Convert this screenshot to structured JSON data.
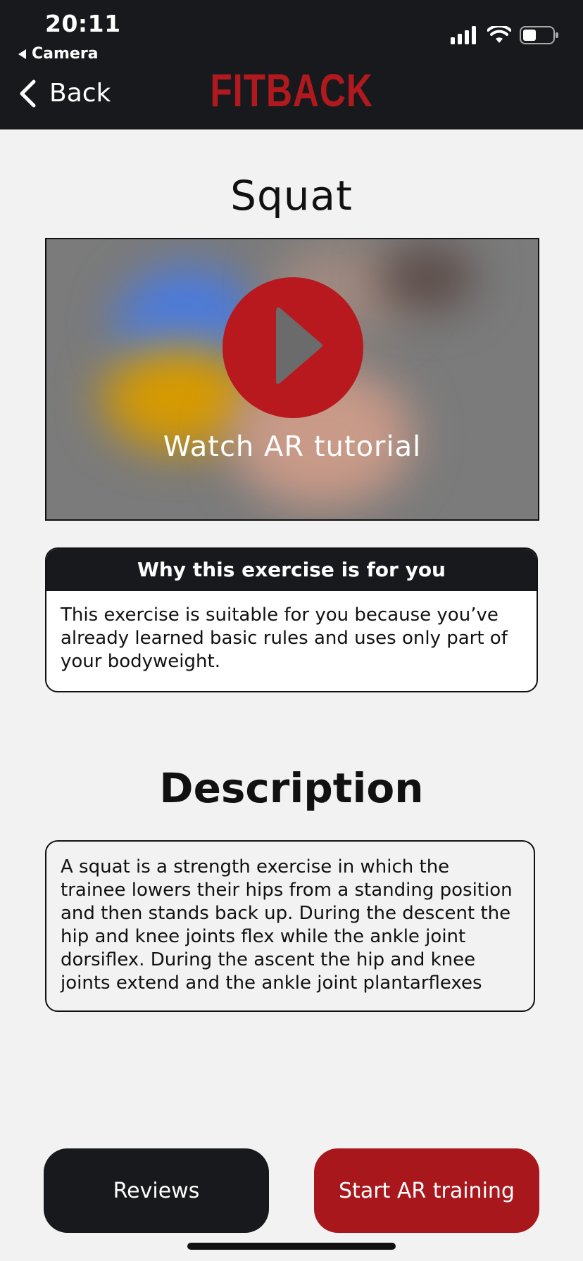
{
  "status_bar": {
    "time": "20:11",
    "back_app": "Camera"
  },
  "nav": {
    "back_label": "Back",
    "logo": "FITBACK"
  },
  "exercise": {
    "title": "Squat",
    "video_label": "Watch AR tutorial"
  },
  "why_card": {
    "title": "Why this exercise is for you",
    "body": "This exercise is suitable for you because you’ve already learned basic rules and uses only part of your bodyweight."
  },
  "description": {
    "heading": "Description",
    "body": "A squat is a strength exercise in which the trainee lowers their hips from a standing position and then stands back up. During the descent the hip and knee joints flex while the ankle joint dorsiflex. During the ascent  the hip and knee joints extend and the ankle joint plantarflexes"
  },
  "buttons": {
    "reviews": "Reviews",
    "start": "Start AR training"
  },
  "colors": {
    "brand_red": "#b0191e",
    "dark": "#17191c",
    "background": "#f2f2f2"
  }
}
